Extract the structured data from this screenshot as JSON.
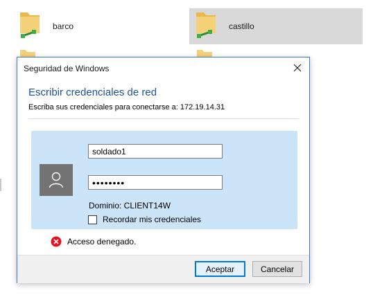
{
  "explorer": {
    "items": [
      {
        "label": "barco",
        "selected": false
      },
      {
        "label": "castillo",
        "selected": true
      }
    ],
    "selection_color": "#d9d9d9"
  },
  "dialog": {
    "title": "Seguridad de Windows",
    "close_icon": "close-icon",
    "heading": "Escribir credenciales de red",
    "subtitle": "Escriba sus credenciales para conectarse a: 172.19.14.31",
    "username_value": "soldado1",
    "password_mask": "••••••••",
    "domain_text": "Dominio: CLIENT14W",
    "remember_label": "Recordar mis credenciales",
    "remember_checked": false,
    "error_text": "Acceso denegado.",
    "ok_label": "Aceptar",
    "cancel_label": "Cancelar",
    "colors": {
      "heading": "#1f4f99",
      "panel": "#cce4f7",
      "border": "#3b79c4",
      "error": "#e81123",
      "default_button": "#0078d7"
    }
  }
}
